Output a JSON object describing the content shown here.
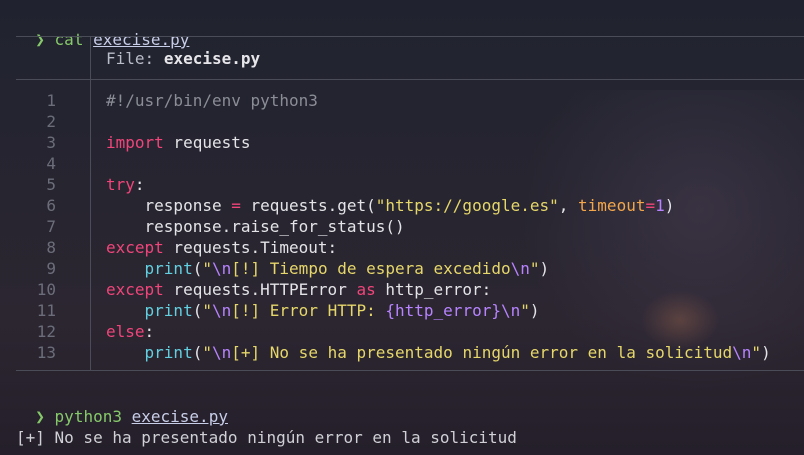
{
  "prompt1": {
    "arrow": "❯",
    "command": "cat",
    "argument": "execise.py"
  },
  "file_header": {
    "label": "File:",
    "name": "execise.py"
  },
  "code_lines": [
    {
      "num": "1",
      "tokens": [
        {
          "t": "#!/usr/bin/env python3",
          "c": "c-comment"
        }
      ]
    },
    {
      "num": "2",
      "tokens": []
    },
    {
      "num": "3",
      "tokens": [
        {
          "t": "import",
          "c": "c-kw"
        },
        {
          "t": " requests",
          "c": "c-text"
        }
      ]
    },
    {
      "num": "4",
      "tokens": []
    },
    {
      "num": "5",
      "tokens": [
        {
          "t": "try",
          "c": "c-kw"
        },
        {
          "t": ":",
          "c": "c-text"
        }
      ]
    },
    {
      "num": "6",
      "tokens": [
        {
          "t": "    response ",
          "c": "c-text"
        },
        {
          "t": "=",
          "c": "c-op"
        },
        {
          "t": " requests.get(",
          "c": "c-text"
        },
        {
          "t": "\"https://google.es\"",
          "c": "c-str"
        },
        {
          "t": ", ",
          "c": "c-text"
        },
        {
          "t": "timeout",
          "c": "c-param"
        },
        {
          "t": "=",
          "c": "c-op"
        },
        {
          "t": "1",
          "c": "c-num"
        },
        {
          "t": ")",
          "c": "c-text"
        }
      ]
    },
    {
      "num": "7",
      "tokens": [
        {
          "t": "    response.raise_for_status()",
          "c": "c-text"
        }
      ]
    },
    {
      "num": "8",
      "tokens": [
        {
          "t": "except",
          "c": "c-kw"
        },
        {
          "t": " requests.Timeout:",
          "c": "c-text"
        }
      ]
    },
    {
      "num": "9",
      "tokens": [
        {
          "t": "    ",
          "c": "c-text"
        },
        {
          "t": "print",
          "c": "c-fn"
        },
        {
          "t": "(",
          "c": "c-text"
        },
        {
          "t": "\"",
          "c": "c-str"
        },
        {
          "t": "\\n",
          "c": "c-esc"
        },
        {
          "t": "[!] Tiempo de espera excedido",
          "c": "c-str"
        },
        {
          "t": "\\n",
          "c": "c-esc"
        },
        {
          "t": "\"",
          "c": "c-str"
        },
        {
          "t": ")",
          "c": "c-text"
        }
      ]
    },
    {
      "num": "10",
      "tokens": [
        {
          "t": "except",
          "c": "c-kw"
        },
        {
          "t": " requests.HTTPError ",
          "c": "c-text"
        },
        {
          "t": "as",
          "c": "c-kw"
        },
        {
          "t": " http_error:",
          "c": "c-text"
        }
      ]
    },
    {
      "num": "11",
      "tokens": [
        {
          "t": "    ",
          "c": "c-text"
        },
        {
          "t": "print",
          "c": "c-fn"
        },
        {
          "t": "(",
          "c": "c-text"
        },
        {
          "t": "\"",
          "c": "c-str"
        },
        {
          "t": "\\n",
          "c": "c-esc"
        },
        {
          "t": "[!] Error HTTP: ",
          "c": "c-str"
        },
        {
          "t": "{http_error}",
          "c": "c-esc"
        },
        {
          "t": "\\n",
          "c": "c-esc"
        },
        {
          "t": "\"",
          "c": "c-str"
        },
        {
          "t": ")",
          "c": "c-text"
        }
      ]
    },
    {
      "num": "12",
      "tokens": [
        {
          "t": "else",
          "c": "c-kw"
        },
        {
          "t": ":",
          "c": "c-text"
        }
      ]
    },
    {
      "num": "13",
      "tokens": [
        {
          "t": "    ",
          "c": "c-text"
        },
        {
          "t": "print",
          "c": "c-fn"
        },
        {
          "t": "(",
          "c": "c-text"
        },
        {
          "t": "\"",
          "c": "c-str"
        },
        {
          "t": "\\n",
          "c": "c-esc"
        },
        {
          "t": "[+] No se ha presentado ningún error en la solicitud",
          "c": "c-str"
        },
        {
          "t": "\\n",
          "c": "c-esc"
        },
        {
          "t": "\"",
          "c": "c-str"
        },
        {
          "t": ")",
          "c": "c-text"
        }
      ]
    }
  ],
  "prompt2": {
    "arrow": "❯",
    "command": "python3",
    "argument": "execise.py"
  },
  "output": "[+] No se ha presentado ningún error en la solicitud"
}
